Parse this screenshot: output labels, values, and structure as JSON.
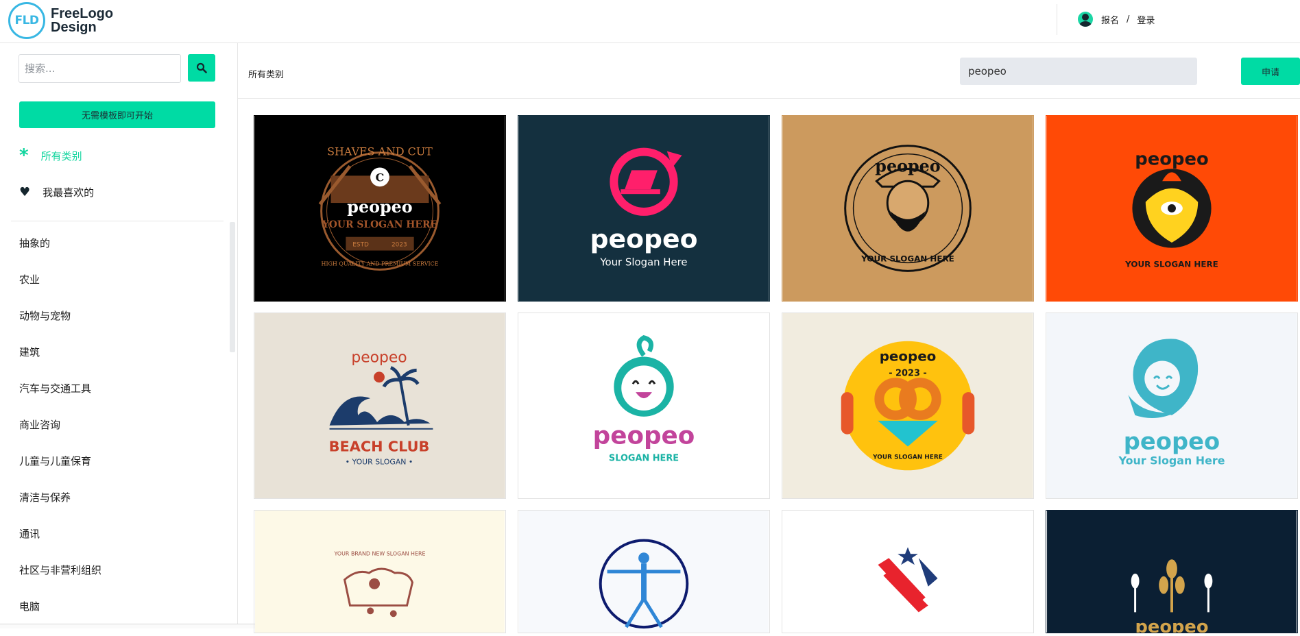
{
  "header": {
    "logo_mark": "FLD",
    "logo_line1": "FreeLogo",
    "logo_line2": "Design",
    "signup": "报名",
    "separator": "/",
    "login": "登录"
  },
  "sidebar": {
    "search_placeholder": "搜索...",
    "start_button": "无需模板即可开始",
    "all_categories": "所有类别",
    "favorites": "我最喜欢的",
    "categories": [
      "抽象的",
      "农业",
      "动物与宠物",
      "建筑",
      "汽车与交通工具",
      "商业咨询",
      "儿童与儿童保育",
      "清洁与保养",
      "通讯",
      "社区与非营利组织",
      "电脑"
    ]
  },
  "main": {
    "breadcrumb": "所有类别",
    "keyword_value": "peopeo",
    "apply_button": "申请"
  },
  "cards": [
    {
      "brand": "peopeo",
      "top_text": "SHAVES AND CUT",
      "initial": "C",
      "slogan": "YOUR SLOGAN HERE",
      "estd": "ESTD",
      "year": "2023",
      "bottom_text": "HIGH QUALITY AND PREMIUM SERVICE",
      "bg": "#000000"
    },
    {
      "brand": "peopeo",
      "slogan": "Your Slogan Here",
      "bg": "#14303f",
      "accent": "#ff1f6b"
    },
    {
      "brand": "peopeo",
      "slogan": "YOUR SLOGAN HERE",
      "bg": "#cc9a5e"
    },
    {
      "brand": "peopeo",
      "slogan": "YOUR SLOGAN HERE",
      "bg": "#ff4a06"
    },
    {
      "brand": "peopeo",
      "title": "BEACH CLUB",
      "slogan": "• YOUR SLOGAN •",
      "bg": "#e8e2d7"
    },
    {
      "brand": "peopeo",
      "slogan": "SLOGAN HERE",
      "bg": "#ffffff"
    },
    {
      "brand": "peopeo",
      "year": "- 2023 -",
      "slogan": "YOUR SLOGAN HERE",
      "bg": "#f1ecdf"
    },
    {
      "brand": "peopeo",
      "slogan": "Your Slogan Here",
      "bg": "#f3f6fa"
    },
    {
      "slogan": "YOUR BRAND NEW SLOGAN HERE",
      "bg": "#fdf9e7"
    },
    {
      "bg": "#f7f9fc"
    },
    {
      "bg": "#ffffff"
    },
    {
      "brand": "peopeo",
      "bg": "#0b1f33"
    }
  ]
}
